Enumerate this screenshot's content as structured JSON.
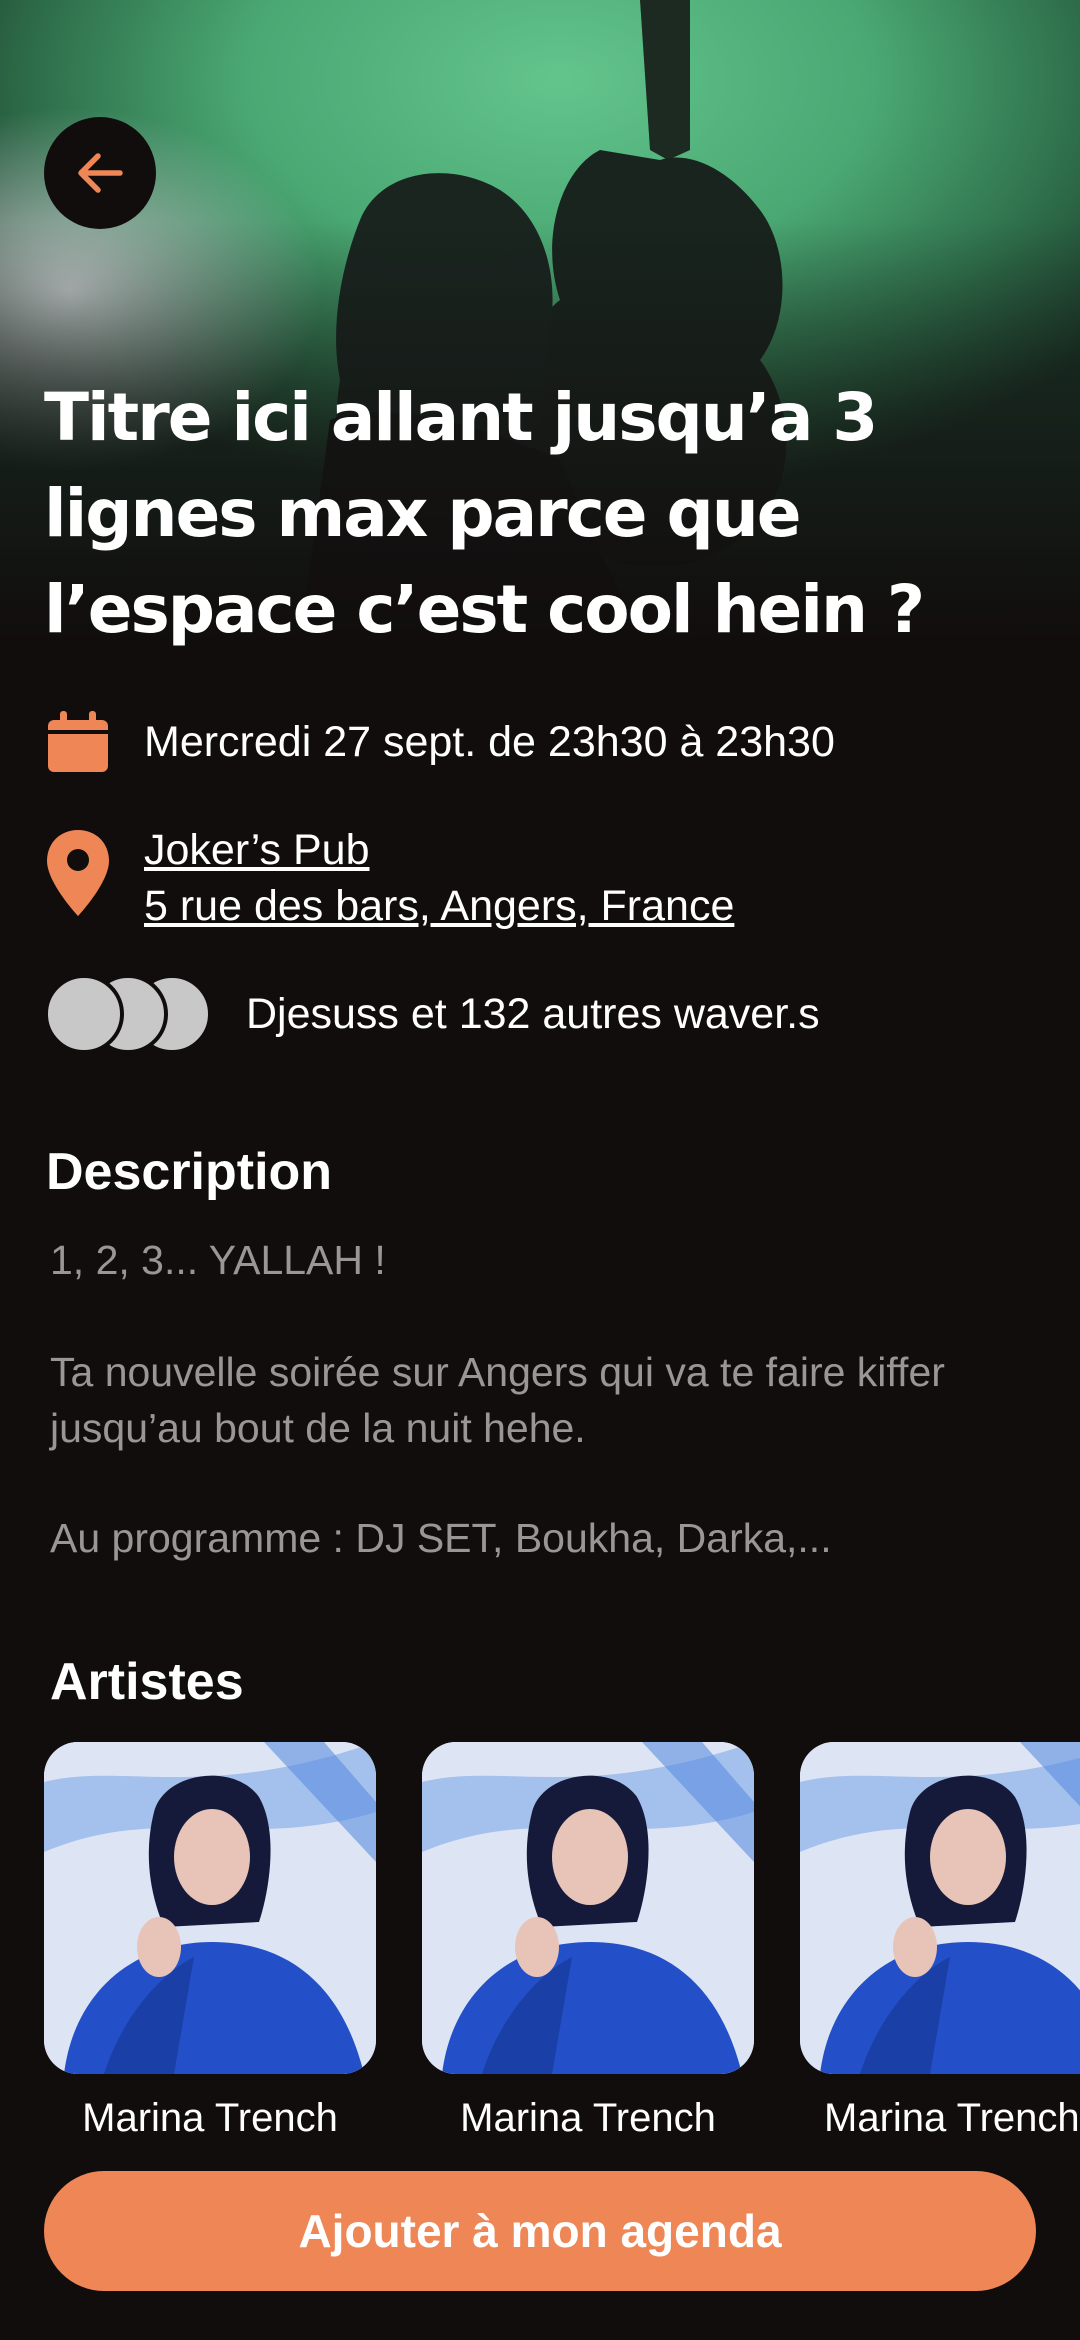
{
  "hero": {
    "title": "Titre ici allant jusqu’a 3 lignes max parce que l’espace c’est cool hein ?"
  },
  "event": {
    "date_text": "Mercredi 27 sept. de 23h30 à 23h30",
    "venue_name": "Joker’s Pub",
    "venue_address": "5 rue des bars, Angers, France",
    "attendees_text": "Djesuss et 132 autres waver.s"
  },
  "description": {
    "heading": "Description",
    "line1": "1, 2, 3... YALLAH !",
    "line2": "Ta nouvelle soirée sur Angers qui va te faire kiffer jusqu’au bout de la nuit hehe.",
    "line3": "Au programme : DJ SET, Boukha, Darka,..."
  },
  "artists": {
    "heading": "Artistes",
    "items": [
      {
        "name": "Marina Trench"
      },
      {
        "name": "Marina Trench"
      },
      {
        "name": "Marina Trench"
      }
    ]
  },
  "cta": {
    "label": "Ajouter à mon agenda"
  },
  "colors": {
    "accent": "#ee8655",
    "background": "#110d0d",
    "muted_text": "#9a9597"
  }
}
